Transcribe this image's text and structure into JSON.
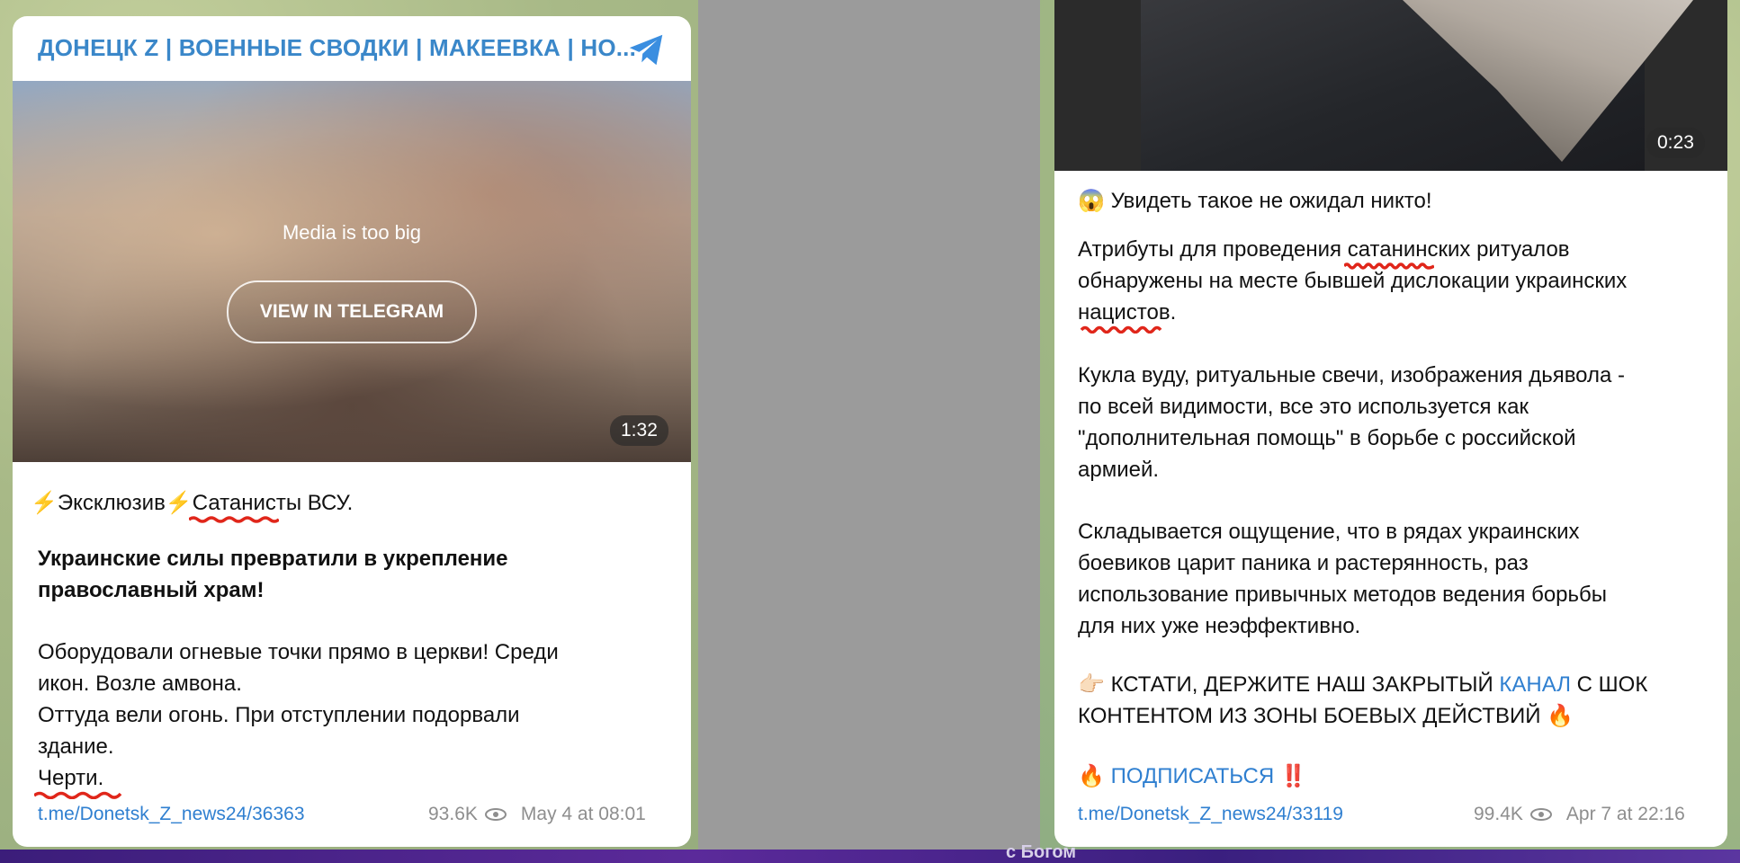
{
  "left_post": {
    "channel_title": "ДОНЕЦК Z | ВОЕННЫЕ СВОДКИ | МАКЕЕВКА | НО...",
    "media_message": "Media is too big",
    "view_button": "VIEW IN TELEGRAM",
    "duration": "1:32",
    "line1_prefix": "⚡Эксклюзив⚡",
    "line1_highlight": "Сатанисты ВСУ.",
    "bold_line1": "Украинские силы превратили в укрепление",
    "bold_line2": "православный храм!",
    "p1": "Оборудовали огневые точки прямо в церкви! Среди",
    "p2": "икон. Возле амвона.",
    "p3": "Оттуда вели огонь. При отступлении подорвали",
    "p4": "здание.",
    "p5": "Черти.",
    "link": "t.me/Donetsk_Z_news24/36363",
    "views": "93.6K",
    "date": "May 4 at 08:01"
  },
  "right_post": {
    "duration": "0:23",
    "emoji_shock": "😱",
    "line1": "Увидеть такое не ожидал никто!",
    "p2_part1": "Атрибуты для проведения ",
    "p2_highlight": "сатанинских ритуалов",
    "p2_line2": "обнаружены на месте бывшей дислокации украинских",
    "p2_highlight2": "нацистов.",
    "p3_l1": "Кукла вуду, ритуальные свечи, изображения дьявола -",
    "p3_l2": "по всей видимости, все это используется как",
    "p3_l3": "\"дополнительная помощь\" в борьбе с российской",
    "p3_l4": "армией.",
    "p4_l1": "Складывается ощущение, что в рядах украинских",
    "p4_l2": "боевиков царит паника и растерянность, раз",
    "p4_l3": "использование привычных методов ведения борьбы",
    "p4_l4": "для них уже неэффективно.",
    "emoji_point": "👉🏻",
    "p5_part1": "КСТАТИ, ДЕРЖИТЕ НАШ ЗАКРЫТЫЙ ",
    "p5_link": "КАНАЛ",
    "p5_part2": " С ШОК",
    "p5_l2": "КОНТЕНТОМ ИЗ ЗОНЫ БОЕВЫХ ДЕЙСТВИЙ",
    "emoji_fire": "🔥",
    "subscribe": "ПОДПИСАТЬСЯ",
    "emoji_bang": "‼️",
    "link": "t.me/Donetsk_Z_news24/33119",
    "views": "99.4K",
    "date": "Apr 7 at 22:16"
  },
  "taskbar_text": "с Богом",
  "colors": {
    "link": "#2f7fd0",
    "title": "#3a87c9",
    "underline": "#e0261a"
  }
}
